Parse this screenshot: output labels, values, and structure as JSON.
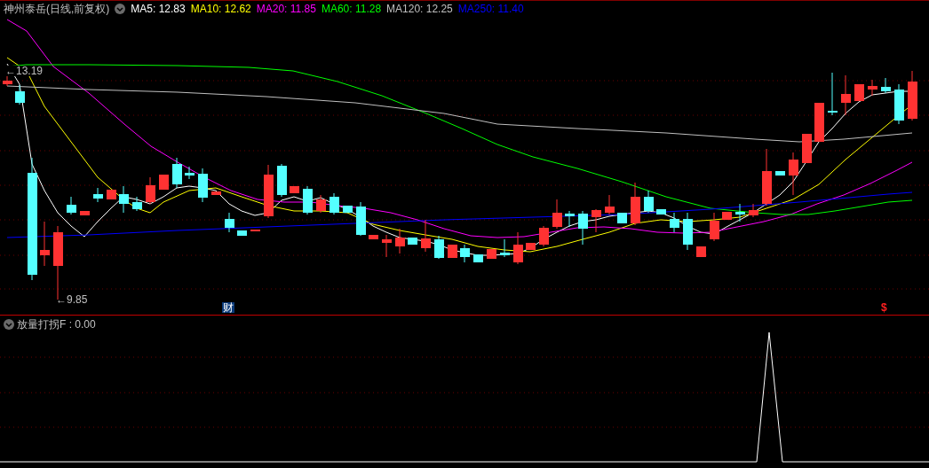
{
  "header": {
    "title": "神州泰岳(日线,前复权)",
    "ma_values": [
      {
        "label": "MA5: 12.83",
        "color": "#ffffff"
      },
      {
        "label": "MA10: 12.62",
        "color": "#ffff00"
      },
      {
        "label": "MA20: 11.85",
        "color": "#ff00ff"
      },
      {
        "label": "MA60: 11.28",
        "color": "#00ff00"
      },
      {
        "label": "MA120: 12.25",
        "color": "#c0c0c0"
      },
      {
        "label": "MA250: 11.40",
        "color": "#0000ff"
      }
    ]
  },
  "price_chart": {
    "high_label": "←13.19",
    "low_label": "←9.85",
    "finance_marker": "财",
    "dividend_marker": "$"
  },
  "indicator": {
    "title": "放量打拐F : 0.00"
  }
}
